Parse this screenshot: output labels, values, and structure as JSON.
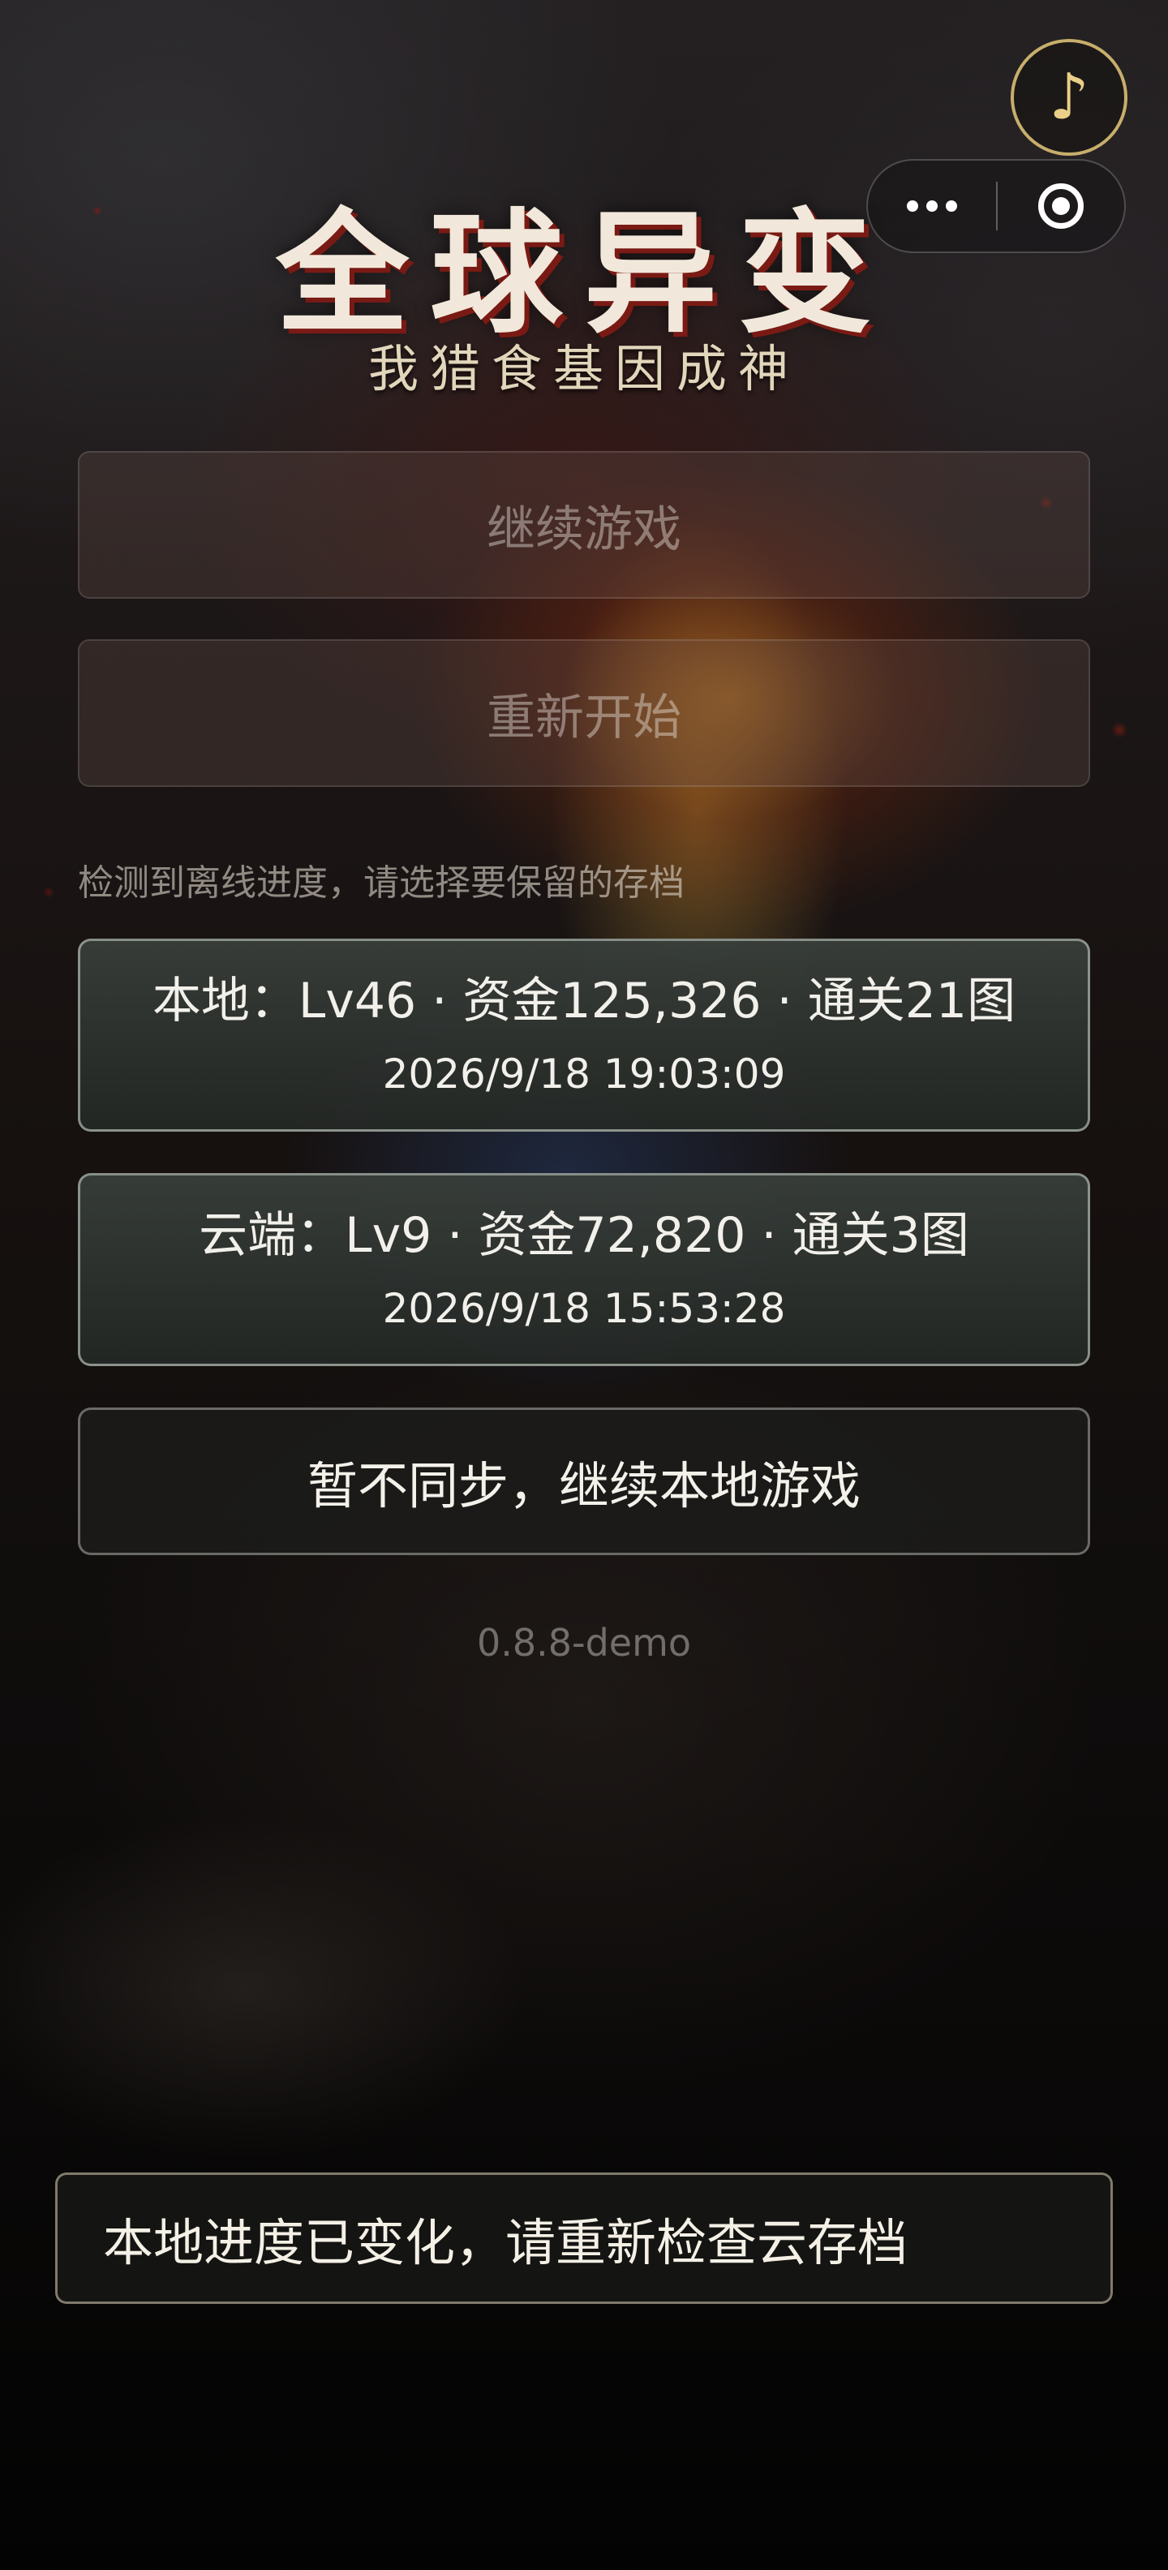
{
  "app": {
    "title": "全球异变",
    "subtitle": "我猎食基因成神"
  },
  "top_controls": {
    "music_icon": "music-note-icon",
    "music_glyph": "♪",
    "capsule_more_icon": "more-dots-icon",
    "capsule_close_icon": "target-circle-icon"
  },
  "menu": {
    "continue_label": "继续游戏",
    "restart_label": "重新开始"
  },
  "sync": {
    "notice": "检测到离线进度，请选择要保留的存档",
    "local": {
      "summary": "本地：Lv46 · 资金125,326 · 通关21图",
      "timestamp": "2026/9/18 19:03:09"
    },
    "cloud": {
      "summary": "云端：Lv9 · 资金72,820 · 通关3图",
      "timestamp": "2026/9/18 15:53:28"
    },
    "skip_label": "暂不同步，继续本地游戏"
  },
  "version": "0.8.8-demo",
  "toast": "本地进度已变化，请重新检查云存档",
  "colors": {
    "title_text": "#f1e8db",
    "title_shadow": "#7a1a14",
    "music_accent": "#c7ae6b",
    "card_bg": "#363b38",
    "card_border": "#aab2aa"
  }
}
